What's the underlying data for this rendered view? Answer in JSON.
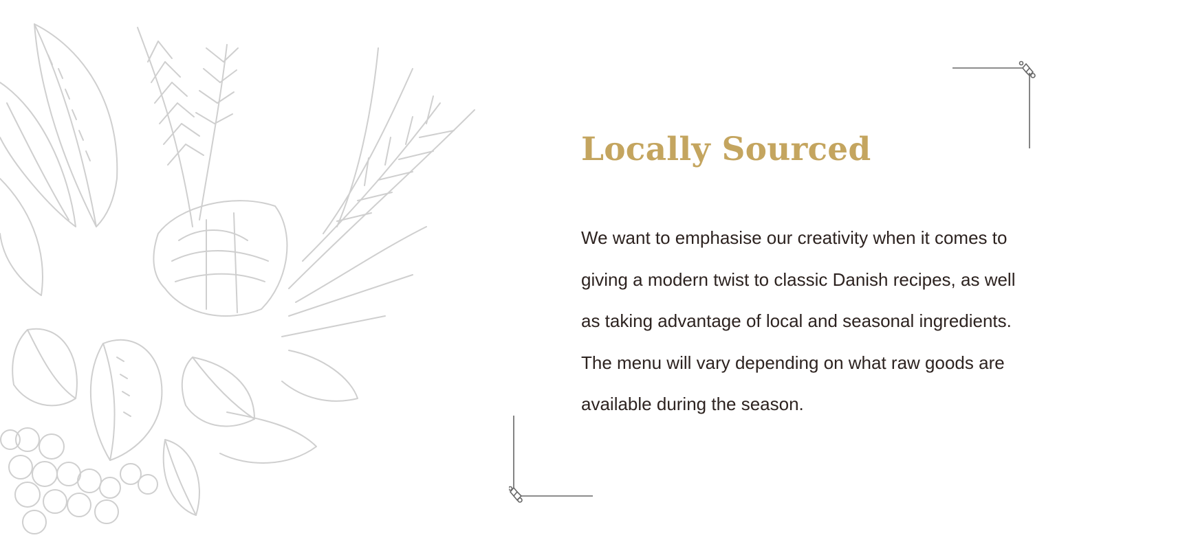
{
  "section": {
    "title": "Locally Sourced",
    "body": "We want to emphasise our creativity when it comes to giving a modern twist to classic Danish recipes, as well as taking advantage of local and seasonal ingredients. The menu will vary depending on what raw goods are available during the season."
  },
  "colors": {
    "title": "#c4a55f",
    "body": "#2d2320",
    "illustration": "#cfcfcf",
    "corner_ornament": "#666666",
    "background": "#ffffff"
  },
  "icons": {
    "illustration": "herb-bouquet-sketch-icon",
    "corner_top_right": "corner-ornament-icon",
    "corner_bottom_left": "corner-ornament-icon"
  }
}
